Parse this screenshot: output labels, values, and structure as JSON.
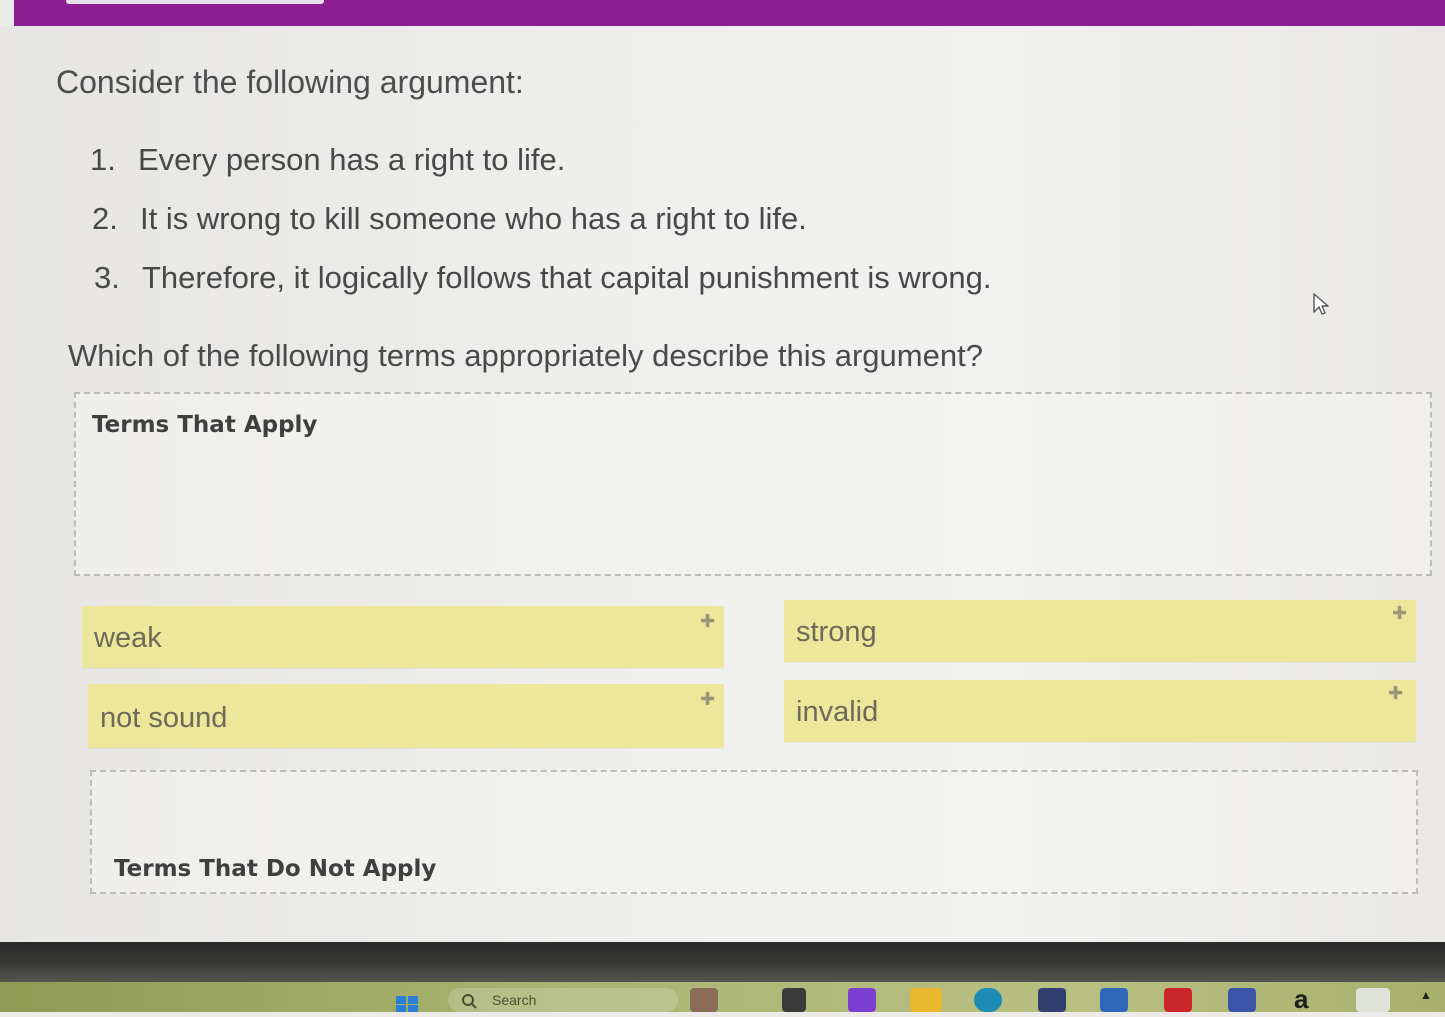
{
  "header": {
    "accent_color": "#8a1e92"
  },
  "prompt": "Consider the following argument:",
  "premises": [
    {
      "num": "1.",
      "text": "Every person has a right to life."
    },
    {
      "num": "2.",
      "text": "It is wrong to kill someone who has a right to life."
    },
    {
      "num": "3.",
      "text": "Therefore, it logically follows that capital punishment is wrong."
    }
  ],
  "question": "Which of the following terms appropriately describe this argument?",
  "zones": {
    "apply_title": "Terms That Apply",
    "not_apply_title": "Terms That Do Not Apply"
  },
  "terms": [
    {
      "label": "weak",
      "handle_icon": "plus-icon"
    },
    {
      "label": "strong",
      "handle_icon": "plus-icon"
    },
    {
      "label": "not sound",
      "handle_icon": "plus-icon"
    },
    {
      "label": "invalid",
      "handle_icon": "plus-icon"
    }
  ],
  "tile_color": "#ede79c",
  "taskbar": {
    "search_placeholder": "Search",
    "amazon_letter": "a",
    "icons": [
      "windows-start-icon",
      "search-icon",
      "widgets-icon",
      "task-view-icon",
      "copilot-icon",
      "file-explorer-icon",
      "edge-icon",
      "store-icon",
      "calculator-icon",
      "mcafee-icon",
      "teams-icon",
      "amazon-icon",
      "tablet-icon",
      "tray-chevron-icon"
    ]
  }
}
